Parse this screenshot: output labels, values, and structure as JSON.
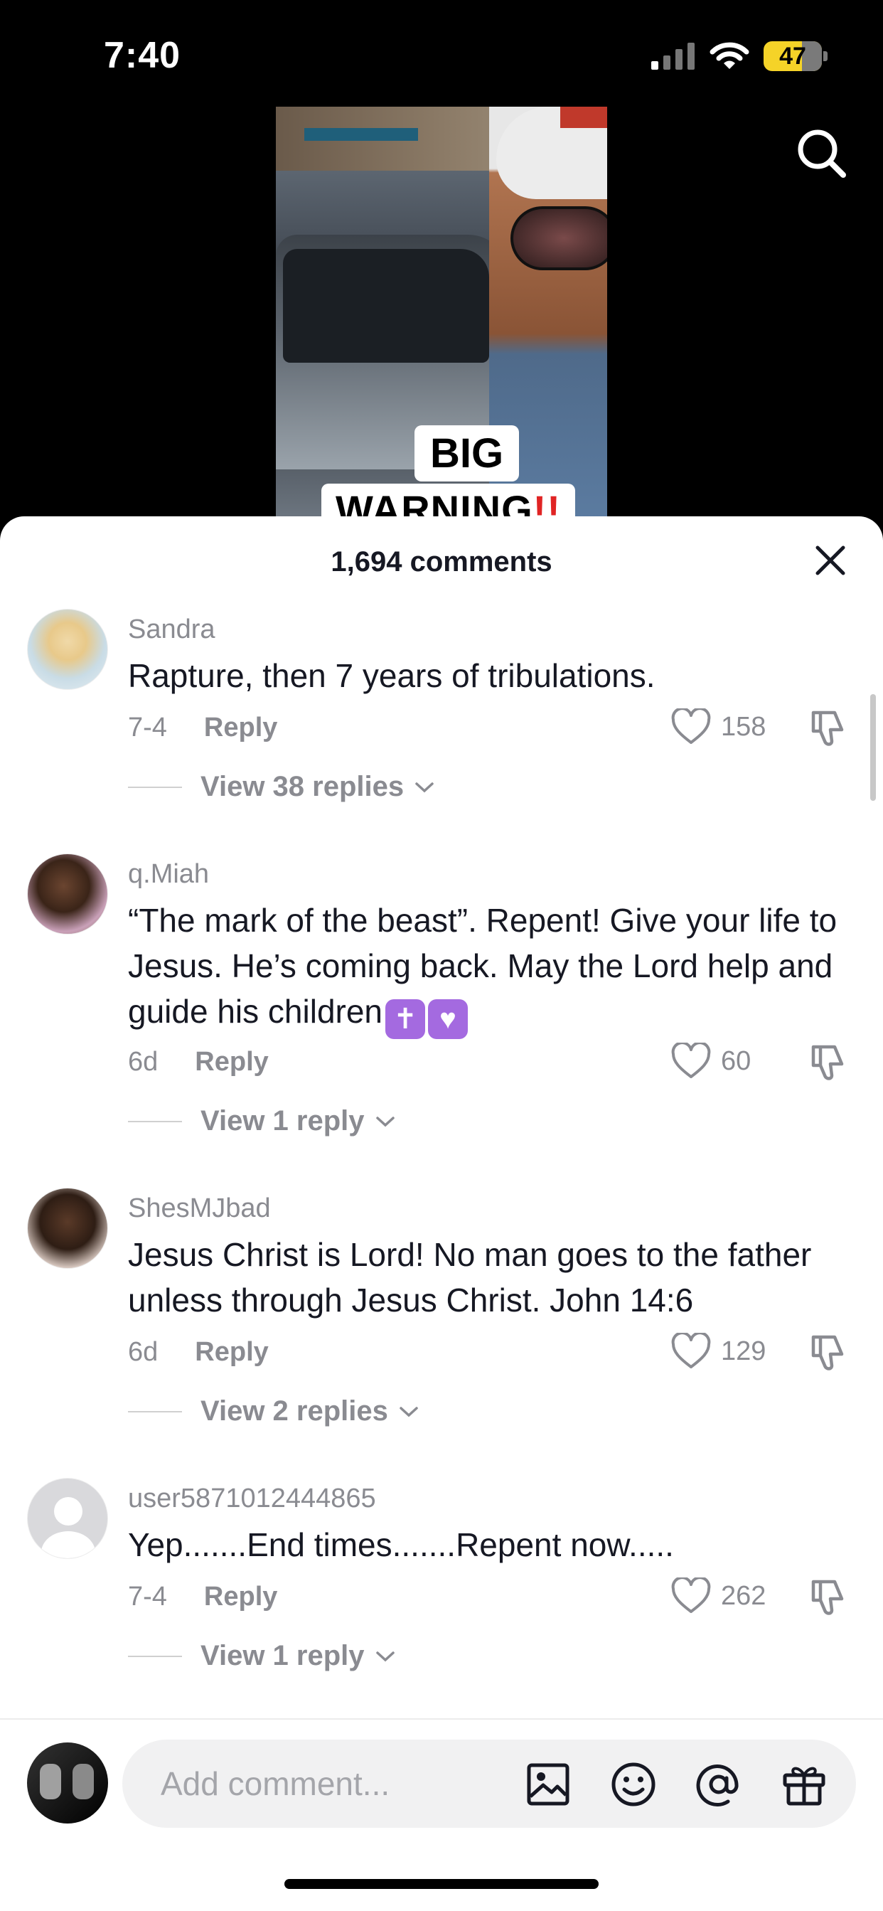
{
  "status_bar": {
    "time": "7:40",
    "battery": "47"
  },
  "video": {
    "caption_line1": "BIG",
    "caption_line2": "WARNING",
    "caption_bang": "!!"
  },
  "sheet": {
    "comment_count": "1,694 comments"
  },
  "comments": [
    {
      "username": "Sandra",
      "text": "Rapture, then 7 years of tribulations.",
      "date": "7-4",
      "reply_label": "Reply",
      "likes": "158",
      "view_replies": "View 38 replies"
    },
    {
      "username": "q.Miah",
      "text": "“The mark of the beast”. Repent! Give your life to Jesus. He’s coming back. May the Lord help and guide his children",
      "emoji1": "✝",
      "emoji2": "♥",
      "date": "6d",
      "reply_label": "Reply",
      "likes": "60",
      "view_replies": "View 1 reply"
    },
    {
      "username": "ShesMJbad",
      "text": "Jesus Christ is Lord! No man goes to the father unless through Jesus Christ. John 14:6",
      "date": "6d",
      "reply_label": "Reply",
      "likes": "129",
      "view_replies": "View 2 replies"
    },
    {
      "username": "user5871012444865",
      "text": "Yep.......End times.......Repent now.....",
      "date": "7-4",
      "reply_label": "Reply",
      "likes": "262",
      "view_replies": "View 1 reply"
    }
  ],
  "composer": {
    "placeholder": "Add comment..."
  },
  "icons": [
    "search-icon",
    "close-icon",
    "heart-icon",
    "dislike-icon",
    "chevron-down-icon",
    "image-icon",
    "emoji-icon",
    "mention-icon",
    "gift-icon"
  ],
  "colors": {
    "text_primary": "#161823",
    "text_secondary": "#8a8b91",
    "battery": "#f5d328",
    "warning_red": "#e02424",
    "emoji_purple": "#a46ae0"
  }
}
